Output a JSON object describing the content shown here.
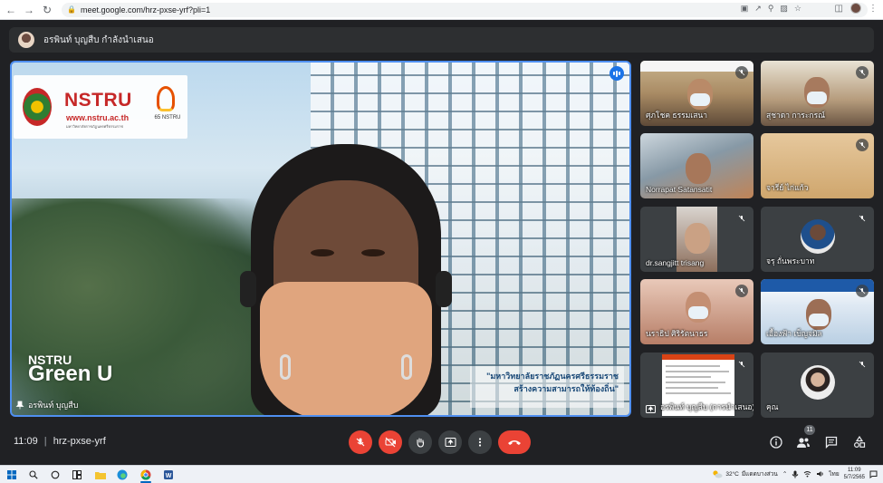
{
  "browser": {
    "url": "meet.google.com/hrz-pxse-yrf?pli=1"
  },
  "presenting": {
    "text": "อรพินท์ บุญสืบ กำลังนำเสนอ"
  },
  "stage": {
    "presenter_name": "อรพินท์ บุญสืบ",
    "logo_text": "NSTRU",
    "logo_url": "www.nstru.ac.th",
    "logo_subtitle": "มหาวิทยาลัยราชภัฏนครศรีธรรมราช",
    "anniversary_text": "65 NSTRU",
    "caption_line1": "\"มหาวิทยาลัยราชภัฏนครศรีธรรมราช",
    "caption_line2": "สร้างความสามารถให้ท้องถิ่น\"",
    "green_u_line1": "NSTRU",
    "green_u_line2": "Green U"
  },
  "participants": [
    {
      "name": "ศุภโชค ธรรมเสนา",
      "muted": true
    },
    {
      "name": "สุชาดา การะกรณ์",
      "muted": true
    },
    {
      "name": "Norrapat Satansatit",
      "muted": false
    },
    {
      "name": "จารีย์ ไก่แก้ว",
      "muted": true
    },
    {
      "name": "dr.sangjitt trisang",
      "muted": true
    },
    {
      "name": "จรุ ถั่นพระบาท",
      "muted": true
    },
    {
      "name": "นราธิป ศิริรัตนาธร",
      "muted": true
    },
    {
      "name": "เอื้องฟ้า เบ็ญจมิล",
      "muted": true
    },
    {
      "name": "อรพินท์ บุญสืบ (การนำเสนอ)",
      "muted": true
    },
    {
      "name": "คุณ",
      "muted": true
    }
  ],
  "bottom_bar": {
    "time": "11:09",
    "meeting_code": "hrz-pxse-yrf",
    "people_count": "11"
  },
  "taskbar": {
    "temperature": "32°C",
    "weather_text": "มีแดดบางส่วน",
    "language": "ไทย",
    "clock_time": "11:09",
    "clock_date": "5/7/2565"
  },
  "colors": {
    "meet_background": "#202124",
    "end_call_red": "#ea4335",
    "speaking_blue": "#1a73e8",
    "stage_border": "#4f8ff0"
  }
}
